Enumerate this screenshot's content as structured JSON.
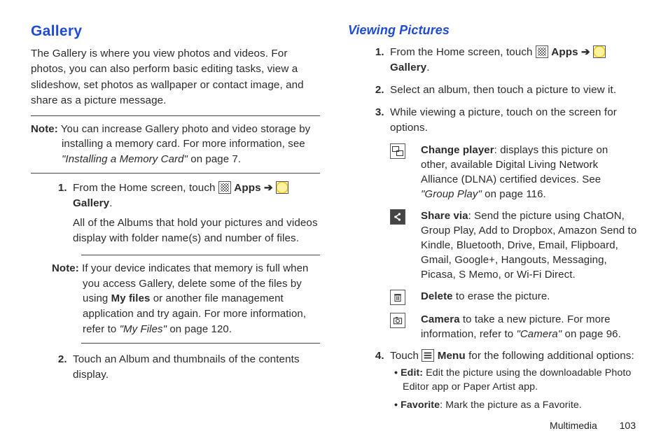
{
  "left": {
    "heading": "Gallery",
    "intro": "The Gallery is where you view photos and videos. For photos, you can also perform basic editing tasks, view a slideshow, set photos as wallpaper or contact image, and share as a picture message.",
    "note1_label": "Note:",
    "note1_text_a": " You can increase Gallery photo and video storage by installing a memory card. For more information, see ",
    "note1_ref": "\"Installing a Memory Card\"",
    "note1_text_b": " on page 7.",
    "steps": {
      "s1_a": "From the Home screen, touch ",
      "apps_label": "Apps",
      "arrow": " ➔ ",
      "gallery_label": "Gallery",
      "s1_after": "All of the Albums that hold your pictures and videos display with folder name(s) and number of files.",
      "s2": "Touch an Album and thumbnails of the contents display."
    },
    "note2_label": "Note:",
    "note2_text_a": " If your device indicates that memory is full when you access Gallery, delete some of the files by using ",
    "note2_myfiles": "My files",
    "note2_text_b": " or another file management application and try again. For more information, refer to ",
    "note2_ref": "\"My Files\"",
    "note2_text_c": " on page 120."
  },
  "right": {
    "heading": "Viewing Pictures",
    "steps": {
      "s1_a": "From the Home screen, touch ",
      "apps_label": "Apps",
      "arrow": " ➔ ",
      "gallery_label": "Gallery",
      "s2": "Select an album, then touch a picture to view it.",
      "s3": "While viewing a picture, touch on the screen for options.",
      "s4_a": "Touch ",
      "menu_label": "Menu",
      "s4_b": " for the following additional options:"
    },
    "options": {
      "change_player_b": "Change player",
      "change_player_a": ": displays this picture on other, available Digital Living Network Alliance (DLNA) certified devices. See ",
      "change_player_ref": "\"Group Play\"",
      "change_player_c": " on page 116.",
      "share_b": "Share via",
      "share_a": ": Send the picture using ChatON, Group Play, Add to Dropbox, Amazon Send to Kindle, Bluetooth, Drive, Email, Flipboard, Gmail, Google+, Hangouts, Messaging, Picasa, S Memo, or Wi-Fi Direct.",
      "delete_b": "Delete",
      "delete_a": " to erase the picture.",
      "camera_b": "Camera",
      "camera_a": " to take a new picture. For more information, refer to ",
      "camera_ref": "\"Camera\"",
      "camera_c": " on page 96."
    },
    "bullets": {
      "edit_b": "Edit:",
      "edit_a": " Edit the picture using the downloadable Photo Editor app or Paper Artist app.",
      "fav_b": "Favorite",
      "fav_a": ": Mark the picture as a Favorite."
    }
  },
  "footer": {
    "chapter": "Multimedia",
    "page": "103"
  }
}
